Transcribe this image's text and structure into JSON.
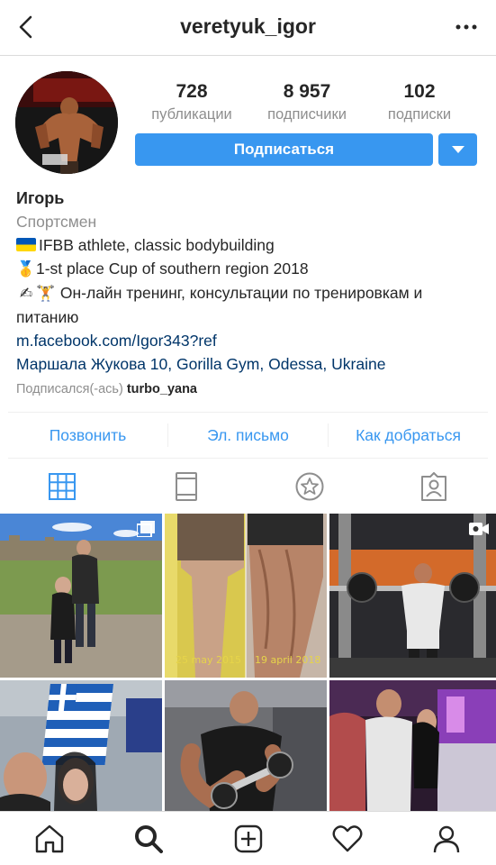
{
  "header": {
    "username": "veretyuk_igor",
    "back_icon": "chevron-left-icon",
    "more_icon": "more-horizontal-icon"
  },
  "profile": {
    "stats": [
      {
        "value": "728",
        "label": "публикации"
      },
      {
        "value": "8 957",
        "label": "подписчики"
      },
      {
        "value": "102",
        "label": "подписки"
      }
    ],
    "follow_label": "Подписаться",
    "name": "Игорь",
    "category": "Спортсмен",
    "bio_lines": [
      "IFBB athlete, classic bodybuilding",
      "1-st place Cup of southern region 2018",
      "Он-лайн тренинг, консультации по тренировкам и питанию"
    ],
    "link": "m.facebook.com/Igor343?ref",
    "address": "Маршала Жукова 10, Gorilla Gym, Odessa, Ukraine",
    "followed_by_prefix": "Подписался(-ась)",
    "followed_by_user": "turbo_yana"
  },
  "contacts": {
    "call": "Позвонить",
    "email": "Эл. письмо",
    "directions": "Как добраться"
  },
  "tabs": [
    "grid-icon",
    "feed-icon",
    "saved-star-icon",
    "tagged-icon"
  ],
  "posts": [
    {
      "icon": "multiple-posts-icon"
    },
    {
      "caption_left": "25 may 2015",
      "caption_right": "19 april 2018"
    },
    {
      "icon": "video-icon"
    },
    {},
    {},
    {}
  ],
  "bottom_nav": [
    "home-icon",
    "search-icon",
    "new-post-icon",
    "activity-heart-icon",
    "profile-icon"
  ],
  "colors": {
    "accent": "#3897f0",
    "text": "#262626",
    "secondary": "#8e8e8e",
    "link": "#003569"
  }
}
